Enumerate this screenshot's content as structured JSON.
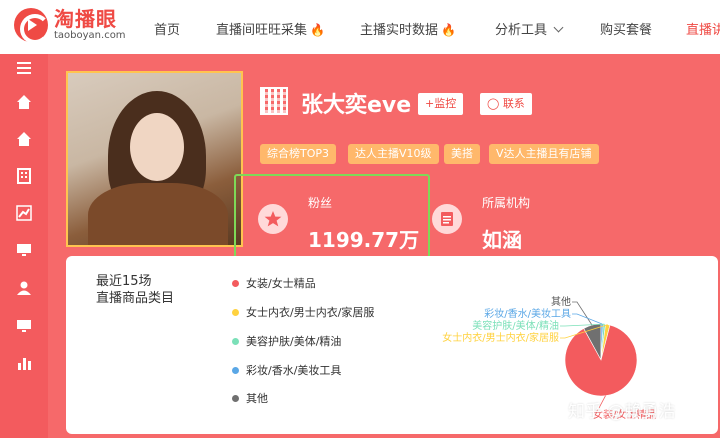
{
  "brand": {
    "name": "淘播眼",
    "domain": "taoboyan.com",
    "color": "#ef4a44"
  },
  "nav": {
    "items": [
      {
        "label": "首页",
        "fire": false,
        "dropdown": false
      },
      {
        "label": "直播间旺旺采集",
        "fire": true,
        "dropdown": false
      },
      {
        "label": "主播实时数据",
        "fire": true,
        "dropdown": false
      },
      {
        "label": "分析工具",
        "fire": false,
        "dropdown": true
      },
      {
        "label": "购买套餐",
        "fire": false,
        "dropdown": false
      },
      {
        "label": "直播讲",
        "fire": false,
        "dropdown": false
      }
    ]
  },
  "sidebar": {
    "icons": [
      "menu-icon",
      "home-icon",
      "home-icon",
      "building-icon",
      "trend-icon",
      "monitor-icon",
      "user-icon",
      "monitor-icon",
      "bar-chart-icon"
    ]
  },
  "profile": {
    "name": "张大奕eve",
    "monitor_label": "+监控",
    "contact_label": "联系",
    "tags": [
      "综合榜TOP3",
      "达人主播V10级",
      "美搭",
      "V达人主播且有店铺"
    ],
    "fans_label": "粉丝",
    "fans_value": "1199.77万",
    "org_label": "所属机构",
    "org_value": "如涵"
  },
  "panel": {
    "title_line1": "最近15场",
    "title_line2": "直播商品类目"
  },
  "chart_data": {
    "type": "pie",
    "categories": [
      "女装/女士精品",
      "女士内衣/男士内衣/家居服",
      "美容护肤/美体/精油",
      "彩妆/香水/美妆工具",
      "其他"
    ],
    "values": [
      88,
      2,
      1,
      1,
      8
    ],
    "colors": [
      "#f35b5e",
      "#ffd23f",
      "#7be0b8",
      "#5aa7e6",
      "#707070"
    ],
    "legend_placement": "left"
  },
  "watermark": "知乎 @赖勇浩"
}
